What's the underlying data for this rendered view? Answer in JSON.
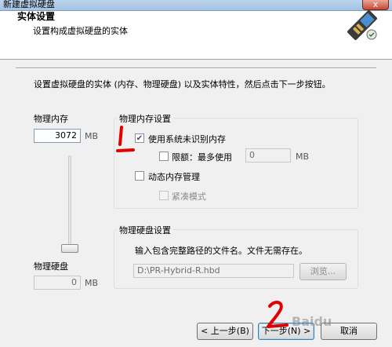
{
  "window": {
    "title": "新建虚拟硬盘",
    "close_label": "x"
  },
  "header": {
    "title": "实体设置",
    "subtitle": "设置构成虚拟硬盘的实体"
  },
  "description": "设置虚拟硬盘的实体 (内存、物理硬盘) 以及实体特性，然后点击下一步按钮。",
  "left": {
    "memory_label": "物理内存",
    "memory_value": "3072",
    "memory_unit": "MB",
    "disk_label": "物理硬盘",
    "disk_value": "0",
    "disk_unit": "MB",
    "slider_fraction": 0.03
  },
  "memory_group": {
    "title": "物理内存设置",
    "use_unrecognized_label": "使用系统未识别内存",
    "use_unrecognized_checked": true,
    "limit_label": "限额：最多使用",
    "limit_value": "0",
    "limit_unit": "MB",
    "dynamic_label": "动态内存管理",
    "compact_label": "紧凑模式",
    "check_mark": "✔"
  },
  "disk_group": {
    "title": "物理硬盘设置",
    "hint": "输入包含完整路径的文件名。文件无需存在。",
    "path_value": "D:\\PR-Hybrid-R.hbd",
    "browse_label": "浏览..."
  },
  "buttons": {
    "back": "< 上一步(B)",
    "next": "下一步(N) >",
    "cancel": "取消"
  },
  "annotations": {
    "mark1": "1",
    "mark2": "2"
  },
  "watermark": "Baidu"
}
